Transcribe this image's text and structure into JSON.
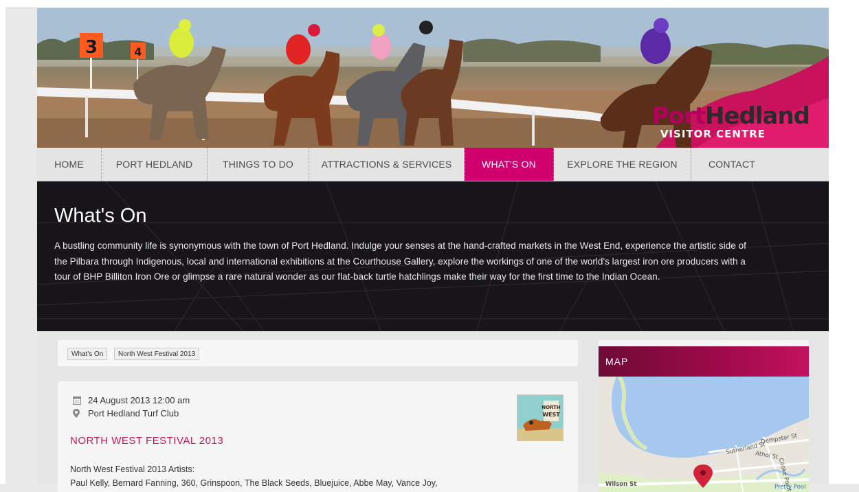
{
  "banner": {
    "logo_primary": "Port",
    "logo_secondary": "Hedland",
    "logo_sub": "VISITOR CENTRE",
    "post_numbers": [
      "3",
      "4"
    ]
  },
  "nav": {
    "items": [
      {
        "label": "HOME",
        "active": false
      },
      {
        "label": "PORT HEDLAND",
        "active": false
      },
      {
        "label": "THINGS TO DO",
        "active": false
      },
      {
        "label": "ATTRACTIONS & SERVICES",
        "active": false
      },
      {
        "label": "WHAT'S ON",
        "active": true
      },
      {
        "label": "EXPLORE THE REGION",
        "active": false
      },
      {
        "label": "CONTACT",
        "active": false
      }
    ]
  },
  "hero": {
    "title": "What's On",
    "text": "A bustling community life is synonymous with the town of Port Hedland. Indulge your senses at the hand-crafted markets in the West End, experience the artistic side of the Pilbara through Indigenous, local and international exhibitions at the Courthouse Gallery, explore the workings of one of the world's largest iron ore producers with a tour of BHP Billiton Iron Ore or glimpse a rare natural wonder as our flat-back turtle hatchlings make their way for the first time to the Indian Ocean."
  },
  "breadcrumb": {
    "items": [
      "What's On",
      "North West Festival 2013"
    ]
  },
  "event": {
    "date": "24 August 2013 12:00 am",
    "venue": "Port Hedland Turf Club",
    "title": "NORTH WEST FESTIVAL 2013",
    "body_line1": "North West Festival 2013 Artists:",
    "body_line2": "Paul Kelly, Bernard Fanning, 360, Grinspoon, The Black Seeds, Bluejuice, Abbe May, Vance Joy,",
    "thumb_text": "NORTH WEST",
    "icons": {
      "date": "calendar-icon",
      "venue": "map-pin-icon"
    }
  },
  "sidebar": {
    "map_title": "MAP",
    "map_labels": {
      "street_1": "Sutherland St",
      "street_2": "Dempster St",
      "street_3": "Athol St",
      "street_4": "Cooke Point",
      "street_5": "Wilson St",
      "place_1": "Pretty Pool"
    }
  },
  "colors": {
    "accent": "#d0006f",
    "hero_bg": "#17141a",
    "event_title": "#c2185b"
  }
}
